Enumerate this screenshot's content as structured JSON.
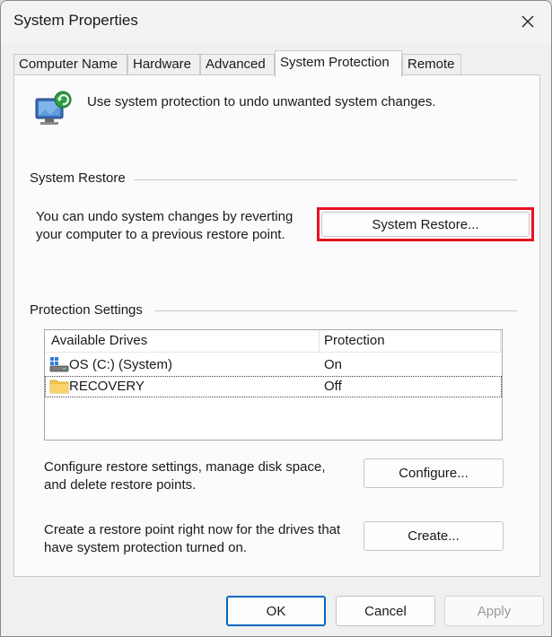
{
  "window": {
    "title": "System Properties",
    "close_icon": "close-icon"
  },
  "tabs": [
    {
      "label": "Computer Name",
      "active": false
    },
    {
      "label": "Hardware",
      "active": false
    },
    {
      "label": "Advanced",
      "active": false
    },
    {
      "label": "System Protection",
      "active": true
    },
    {
      "label": "Remote",
      "active": false
    }
  ],
  "intro": {
    "icon": "system-protection-icon",
    "text": "Use system protection to undo unwanted system changes."
  },
  "system_restore": {
    "group_label": "System Restore",
    "description_line1": "You can undo system changes by reverting",
    "description_line2": "your computer to a previous restore point.",
    "button_label": "System Restore...",
    "highlight_color": "#e81224"
  },
  "protection_settings": {
    "group_label": "Protection Settings",
    "columns": [
      "Available Drives",
      "Protection"
    ],
    "drives": [
      {
        "name": "OS (C:) (System)",
        "protection": "On",
        "icon": "system-drive-icon",
        "selected": false
      },
      {
        "name": "RECOVERY",
        "protection": "Off",
        "icon": "folder-drive-icon",
        "selected": true
      }
    ],
    "configure_text_line1": "Configure restore settings, manage disk space,",
    "configure_text_line2": "and delete restore points.",
    "configure_button": "Configure...",
    "create_text_line1": "Create a restore point right now for the drives that",
    "create_text_line2": "have system protection turned on.",
    "create_button": "Create..."
  },
  "footer": {
    "ok": "OK",
    "cancel": "Cancel",
    "apply": "Apply"
  },
  "colors": {
    "accent": "#0067c0",
    "panel_bg": "#fbfbfb",
    "window_bg": "#f0f0f0"
  }
}
